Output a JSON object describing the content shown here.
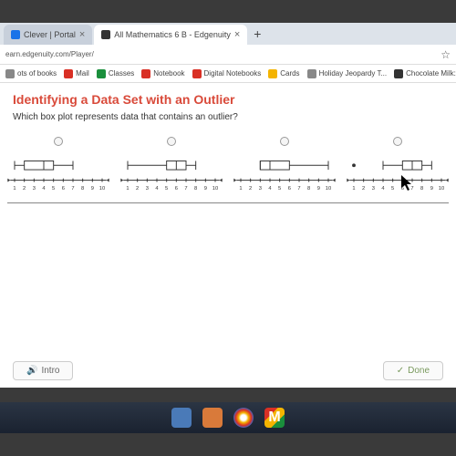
{
  "tabs": {
    "t1": {
      "title": "Clever | Portal",
      "iconColor": "#1a73e8"
    },
    "t2": {
      "title": "All Mathematics 6 B - Edgenuity",
      "iconColor": "#333"
    }
  },
  "url": "earn.edgenuity.com/Player/",
  "bookmarks": {
    "b1": {
      "label": "ots of books",
      "color": "#888"
    },
    "b2": {
      "label": "Mail",
      "color": "#d93025"
    },
    "b3": {
      "label": "Classes",
      "color": "#1a8f3c"
    },
    "b4": {
      "label": "Notebook",
      "color": "#d93025"
    },
    "b5": {
      "label": "Digital Notebooks",
      "color": "#d93025"
    },
    "b6": {
      "label": "Cards",
      "color": "#f4b400"
    },
    "b7": {
      "label": "Holiday Jeopardy T...",
      "color": "#888"
    },
    "b8": {
      "label": "Chocolate Milk: Nut...",
      "color": "#333"
    }
  },
  "question": {
    "title": "Identifying a Data Set with an Outlier",
    "prompt": "Which box plot represents data that contains an outlier?"
  },
  "buttons": {
    "intro": "Intro",
    "done": "Done"
  },
  "chart_data": [
    {
      "type": "boxplot",
      "min": 1,
      "q1": 2,
      "median": 4,
      "q3": 5,
      "max": 7,
      "xticks": [
        1,
        2,
        3,
        4,
        5,
        6,
        7,
        8,
        9,
        10
      ],
      "outliers": []
    },
    {
      "type": "boxplot",
      "min": 1,
      "q1": 5,
      "median": 6,
      "q3": 7,
      "max": 8,
      "xticks": [
        1,
        2,
        3,
        4,
        5,
        6,
        7,
        8,
        9,
        10
      ],
      "outliers": []
    },
    {
      "type": "boxplot",
      "min": 3,
      "q1": 3,
      "median": 4,
      "q3": 6,
      "max": 10,
      "xticks": [
        1,
        2,
        3,
        4,
        5,
        6,
        7,
        8,
        9,
        10
      ],
      "outliers": []
    },
    {
      "type": "boxplot",
      "min": 4,
      "q1": 6,
      "median": 7,
      "q3": 8,
      "max": 9,
      "xticks": [
        1,
        2,
        3,
        4,
        5,
        6,
        7,
        8,
        9,
        10
      ],
      "outliers": [
        1
      ]
    }
  ]
}
